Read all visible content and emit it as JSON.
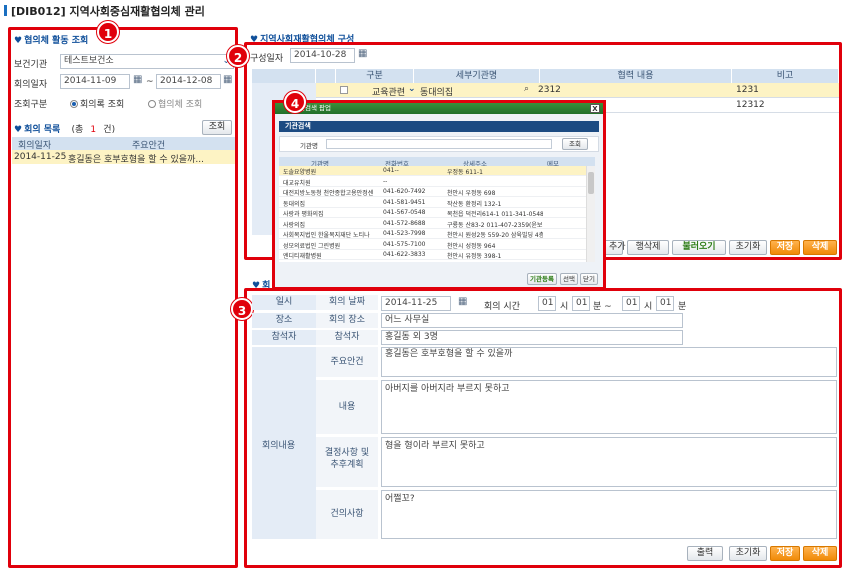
{
  "page_title": "[DIB012] 지역사회중심재활협의체 관리",
  "left": {
    "section_title": "협의체 활동 조회",
    "health_center_label": "보건기관",
    "health_center_value": "테스트보건소",
    "date_label": "회의일자",
    "date_from": "2014-11-09",
    "date_tilde": "~",
    "date_to": "2014-12-08",
    "type_label": "조회구분",
    "radio_meeting": "회의록 조회",
    "radio_council": "협의체 조회",
    "list_title": "회의 목록",
    "list_count_prefix": "(총",
    "list_count": "1",
    "list_count_suffix": "건)",
    "search_button": "조회",
    "col_date": "회의일자",
    "col_agenda": "주요안건",
    "rows": [
      {
        "date": "2014-11-25",
        "agenda": "홍길동은 호부호형을 할 수 있을까..."
      }
    ]
  },
  "council": {
    "section_title": "지역사회재활협의체 구성",
    "date_label": "구성일자",
    "date_value": "2014-10-28",
    "col_type": "구분",
    "col_org": "세부기관명",
    "col_content": "협력 내용",
    "col_note": "비고",
    "rows": [
      {
        "type": "교육관련",
        "org": "동대의집",
        "content": "2312",
        "note": "1231"
      },
      {
        "type": "",
        "org": "",
        "content": "",
        "note": "12312"
      }
    ],
    "side_char": "협",
    "buttons": {
      "add": "추가",
      "delete_row": "행삭제",
      "load": "불러오기",
      "reset": "초기화",
      "save": "저장",
      "delete": "삭제"
    }
  },
  "meeting": {
    "section_title": "회",
    "when_label": "일시",
    "meeting_date_label": "회의 날짜",
    "meeting_date_value": "2014-11-25",
    "meeting_time_label": "회의 시간",
    "h1": "01",
    "hour1": "시",
    "m1": "01",
    "min1": "분 ~",
    "h2": "01",
    "hour2": "시",
    "m2": "01",
    "min2": "분",
    "place_label": "장소",
    "place_field_label": "회의 장소",
    "place_value": "어느 사무실",
    "attendee_label": "참석자",
    "attendee_field_label": "참석자",
    "attendee_value": "홍길동 외 3명",
    "content_label": "회의내용",
    "agenda_label": "주요안건",
    "agenda_value": "홍길동은 호부호형을 할 수 있을까",
    "body_label": "내용",
    "body_value": "아버지를 아버지라 부르지 못하고",
    "decision_label": "결정사항 및 추후계획",
    "decision_value": "형을 형이라 부르지 못하고",
    "suggest_label": "건의사항",
    "suggest_value": "어쩔꼬?",
    "buttons": {
      "print": "출력",
      "reset": "초기화",
      "save": "저장",
      "delete": "삭제"
    }
  },
  "popup": {
    "title": "기관검색 팝업",
    "close": "X",
    "tab": "기관검색",
    "search_label": "기관명",
    "search_button": "조회",
    "cols": [
      "기관명",
      "전화번호",
      "상세주소",
      "메모"
    ],
    "rows": [
      {
        "name": "도솔요양병원",
        "tel": "041--",
        "addr": "우정동 611-1",
        "memo": ""
      },
      {
        "name": "대교유치원",
        "tel": "--",
        "addr": "",
        "memo": ""
      },
      {
        "name": "대전지방노동청 천안종합고용안정센",
        "tel": "041-620-7492",
        "addr": "천안시 우정동 698",
        "memo": ""
      },
      {
        "name": "동대의집",
        "tel": "041-581-9451",
        "addr": "작산동 환정리 132-1",
        "memo": ""
      },
      {
        "name": "사랑과 평화의집",
        "tel": "041-567-0548",
        "addr": "목천읍 덕전리614-1 011-341-0548",
        "memo": ""
      },
      {
        "name": "사랑의집",
        "tel": "041-572-8688",
        "addr": "구룡동 산83-2 011-407-2359(윤보",
        "memo": ""
      },
      {
        "name": "사회복지법인 한울복지재단 노티나",
        "tel": "041-523-7998",
        "addr": "천안시 원성2동 559-20 삼육빌딩 4층",
        "memo": ""
      },
      {
        "name": "성모의료법인 그린병원",
        "tel": "041-575-7100",
        "addr": "천안시 성정동 964",
        "memo": ""
      },
      {
        "name": "엔디티재활병원",
        "tel": "041-622-3833",
        "addr": "천안시 유정동 398-1",
        "memo": ""
      }
    ],
    "buttons": {
      "register": "기관등록",
      "select": "선택",
      "close": "닫기"
    }
  },
  "badges": [
    "1",
    "2",
    "3",
    "4"
  ]
}
